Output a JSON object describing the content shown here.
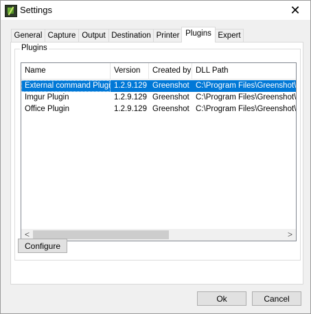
{
  "window": {
    "title": "Settings",
    "close_glyph": "✕"
  },
  "tabs": [
    {
      "label": "General"
    },
    {
      "label": "Capture"
    },
    {
      "label": "Output"
    },
    {
      "label": "Destination"
    },
    {
      "label": "Printer"
    },
    {
      "label": "Plugins",
      "active": true
    },
    {
      "label": "Expert"
    }
  ],
  "plugins_group": {
    "label": "Plugins",
    "columns": [
      "Name",
      "Version",
      "Created by",
      "DLL Path"
    ],
    "rows": [
      [
        "External command Plugin",
        "1.2.9.129",
        "Greenshot",
        "C:\\Program Files\\Greenshot\\Plugi"
      ],
      [
        "Imgur Plugin",
        "1.2.9.129",
        "Greenshot",
        "C:\\Program Files\\Greenshot\\Plugi"
      ],
      [
        "Office Plugin",
        "1.2.9.129",
        "Greenshot",
        "C:\\Program Files\\Greenshot\\Plugi"
      ]
    ],
    "selected_row": 0,
    "scroll_left_glyph": "<",
    "scroll_right_glyph": ">",
    "configure_label": "Configure"
  },
  "footer": {
    "ok_label": "Ok",
    "cancel_label": "Cancel"
  },
  "colors": {
    "selection": "#0078d7",
    "title_bar": "#ffffff",
    "window_bg": "#f0f0f0"
  }
}
